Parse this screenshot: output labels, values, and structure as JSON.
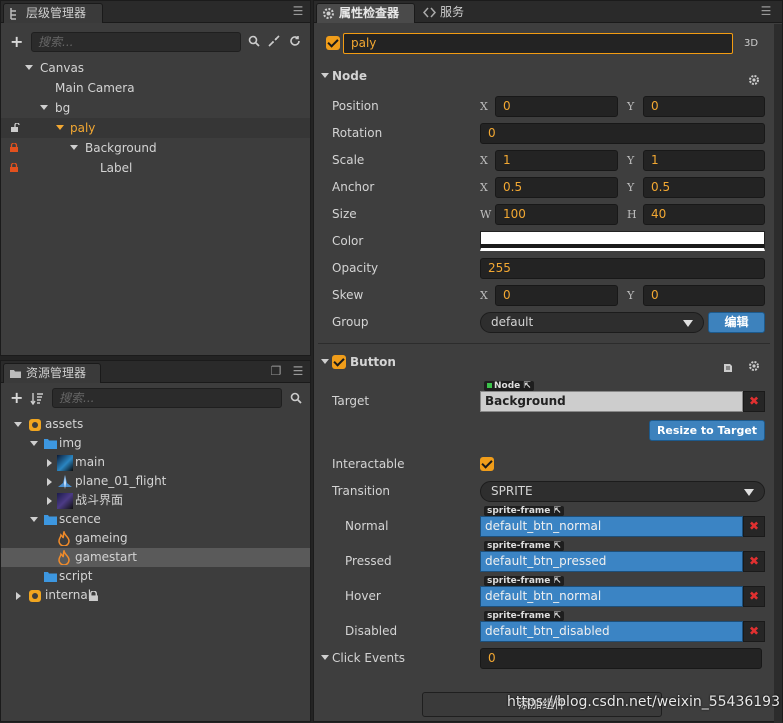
{
  "hierarchy": {
    "tab_label": "层级管理器",
    "search_placeholder": "搜索...",
    "nodes": [
      {
        "label": "Canvas"
      },
      {
        "label": "Main Camera"
      },
      {
        "label": "bg"
      },
      {
        "label": "paly"
      },
      {
        "label": "Background"
      },
      {
        "label": "Label"
      }
    ]
  },
  "assets": {
    "tab_label": "资源管理器",
    "search_placeholder": "搜索...",
    "items": [
      {
        "label": "assets"
      },
      {
        "label": "img"
      },
      {
        "label": "main"
      },
      {
        "label": "plane_01_flight"
      },
      {
        "label": "战斗界面"
      },
      {
        "label": "scence"
      },
      {
        "label": "gameing"
      },
      {
        "label": "gamestart"
      },
      {
        "label": "script"
      },
      {
        "label": "internal"
      }
    ]
  },
  "inspector": {
    "tab_label": "属性检查器",
    "tab2_label": "服务",
    "node_name": "paly",
    "mode_3d": "3D",
    "node_section": "Node",
    "props": {
      "position": {
        "label": "Position",
        "x_axis": "X",
        "x": "0",
        "y_axis": "Y",
        "y": "0"
      },
      "rotation": {
        "label": "Rotation",
        "value": "0"
      },
      "scale": {
        "label": "Scale",
        "x_axis": "X",
        "x": "1",
        "y_axis": "Y",
        "y": "1"
      },
      "anchor": {
        "label": "Anchor",
        "x_axis": "X",
        "x": "0.5",
        "y_axis": "Y",
        "y": "0.5"
      },
      "size": {
        "label": "Size",
        "w_axis": "W",
        "w": "100",
        "h_axis": "H",
        "h": "40"
      },
      "color": {
        "label": "Color",
        "value": "#ffffff"
      },
      "opacity": {
        "label": "Opacity",
        "value": "255"
      },
      "skew": {
        "label": "Skew",
        "x_axis": "X",
        "x": "0",
        "y_axis": "Y",
        "y": "0"
      },
      "group": {
        "label": "Group",
        "value": "default",
        "edit_label": "编辑"
      }
    },
    "button_section": "Button",
    "button": {
      "target_label": "Target",
      "target_tag": "Node",
      "target_value": "Background",
      "resize_label": "Resize to Target",
      "interactable_label": "Interactable",
      "transition_label": "Transition",
      "transition_value": "SPRITE",
      "sprite_tag": "sprite-frame",
      "normal_label": "Normal",
      "normal_value": "default_btn_normal",
      "pressed_label": "Pressed",
      "pressed_value": "default_btn_pressed",
      "hover_label": "Hover",
      "hover_value": "default_btn_normal",
      "disabled_label": "Disabled",
      "disabled_value": "default_btn_disabled",
      "click_events_label": "Click Events",
      "click_events_value": "0",
      "add_component_label": "添加组件"
    }
  },
  "watermark": "https://blog.csdn.net/weixin_55436193"
}
